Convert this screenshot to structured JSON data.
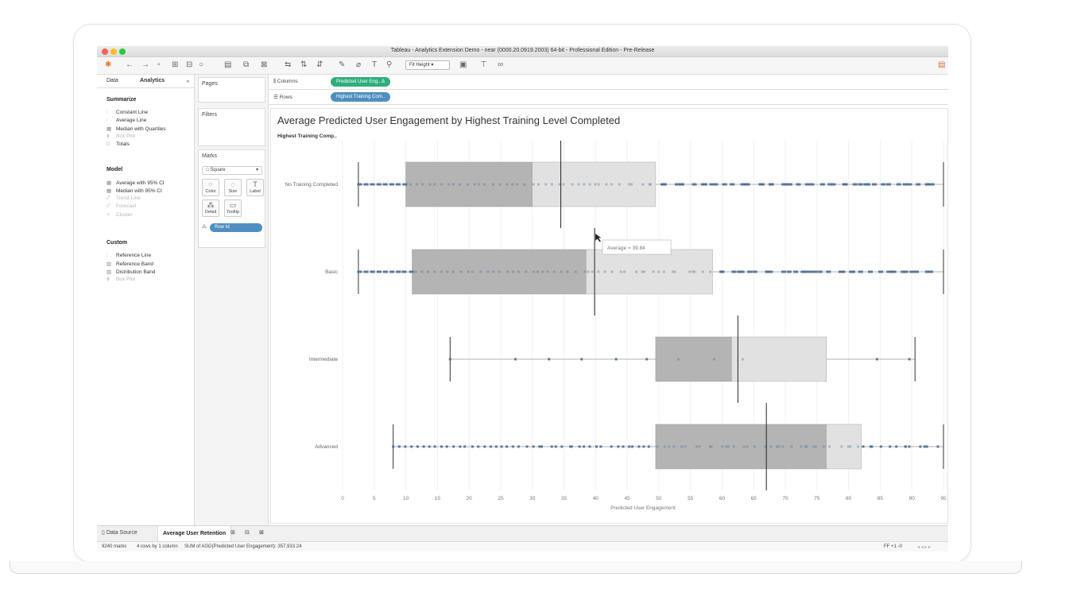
{
  "window": {
    "title": "Tableau - Analytics Extension Demo - near (0000.20.0919.2003) 64-bit - Professional Edition - Pre-Release"
  },
  "toolbar": {
    "fit_label": "Fit Height"
  },
  "left_pane": {
    "tabs": [
      "Data",
      "Analytics"
    ],
    "sections": [
      {
        "title": "Summarize",
        "items": [
          {
            "label": "Constant Line",
            "enabled": true
          },
          {
            "label": "Average Line",
            "enabled": true
          },
          {
            "label": "Median with Quartiles",
            "enabled": true
          },
          {
            "label": "Box Plot",
            "enabled": false
          },
          {
            "label": "Totals",
            "enabled": true
          }
        ]
      },
      {
        "title": "Model",
        "items": [
          {
            "label": "Average with 95% CI",
            "enabled": true
          },
          {
            "label": "Median with 95% CI",
            "enabled": true
          },
          {
            "label": "Trend Line",
            "enabled": false
          },
          {
            "label": "Forecast",
            "enabled": false
          },
          {
            "label": "Cluster",
            "enabled": false
          }
        ]
      },
      {
        "title": "Custom",
        "items": [
          {
            "label": "Reference Line",
            "enabled": true
          },
          {
            "label": "Reference Band",
            "enabled": true
          },
          {
            "label": "Distribution Band",
            "enabled": true
          },
          {
            "label": "Box Plot",
            "enabled": false
          }
        ]
      }
    ]
  },
  "mid_pane": {
    "pages": "Pages",
    "filters": "Filters",
    "marks": "Marks",
    "mark_type": "Square",
    "buttons": [
      "Color",
      "Size",
      "Label",
      "Detail",
      "Tooltip"
    ],
    "detail_pill": "Row Id"
  },
  "shelves": {
    "columns_label": "Columns",
    "columns_pill": "Predicted User Eng.. Δ",
    "rows_label": "Rows",
    "rows_pill": "Highest Training Com.."
  },
  "viz": {
    "title": "Average Predicted User Engagement by Highest Training Level Completed",
    "row_header": "Highest Training Comp..",
    "tooltip": "Average = 39.84"
  },
  "chart_data": {
    "type": "box plot",
    "title": "Average Predicted User Engagement by Highest Training Level Completed",
    "xlabel": "Predicted User Engagement",
    "ylabel": "Highest Training Comp..",
    "xlim": [
      0,
      95
    ],
    "xticks": [
      0,
      5,
      10,
      15,
      20,
      25,
      30,
      35,
      40,
      45,
      50,
      55,
      60,
      65,
      70,
      75,
      80,
      85,
      90,
      95
    ],
    "categories": [
      "No Training Completed",
      "Basic",
      "Intermediate",
      "Advanced"
    ],
    "boxes": [
      {
        "category": "No Training Completed",
        "whisker_low": 2.5,
        "q1": 10,
        "median": 30,
        "q3": 49.5,
        "whisker_high": 95,
        "average": 34.5
      },
      {
        "category": "Basic",
        "whisker_low": 2.5,
        "q1": 11,
        "median": 38.5,
        "q3": 58.5,
        "whisker_high": 95,
        "average": 39.84
      },
      {
        "category": "Intermediate",
        "whisker_low": 17,
        "q1": 49.5,
        "median": 61.5,
        "q3": 76.5,
        "whisker_high": 90.5,
        "average": 62.5
      },
      {
        "category": "Advanced",
        "whisker_low": 8,
        "q1": 49.5,
        "median": 76.5,
        "q3": 82,
        "whisker_high": 95,
        "average": 67
      }
    ],
    "annotations": [
      "Average = 39.84"
    ],
    "grid": true,
    "legend": "none"
  },
  "bottom_tabs": {
    "data_source": "Data Source",
    "sheet": "Average User Retention"
  },
  "status_bar": {
    "marks": "9240 marks",
    "dims": "4 rows by 1 column",
    "sum": "SUM of AGG(Predicted User Engagement): 357,933.24",
    "page": "FF +1 -0"
  },
  "colors": {
    "accent_green": "#2eae7a",
    "accent_teal": "#4f8fbf",
    "mark_blue": "#4e6e96",
    "box_dark": "#b4b4b4",
    "box_light": "#e1e1e1"
  }
}
